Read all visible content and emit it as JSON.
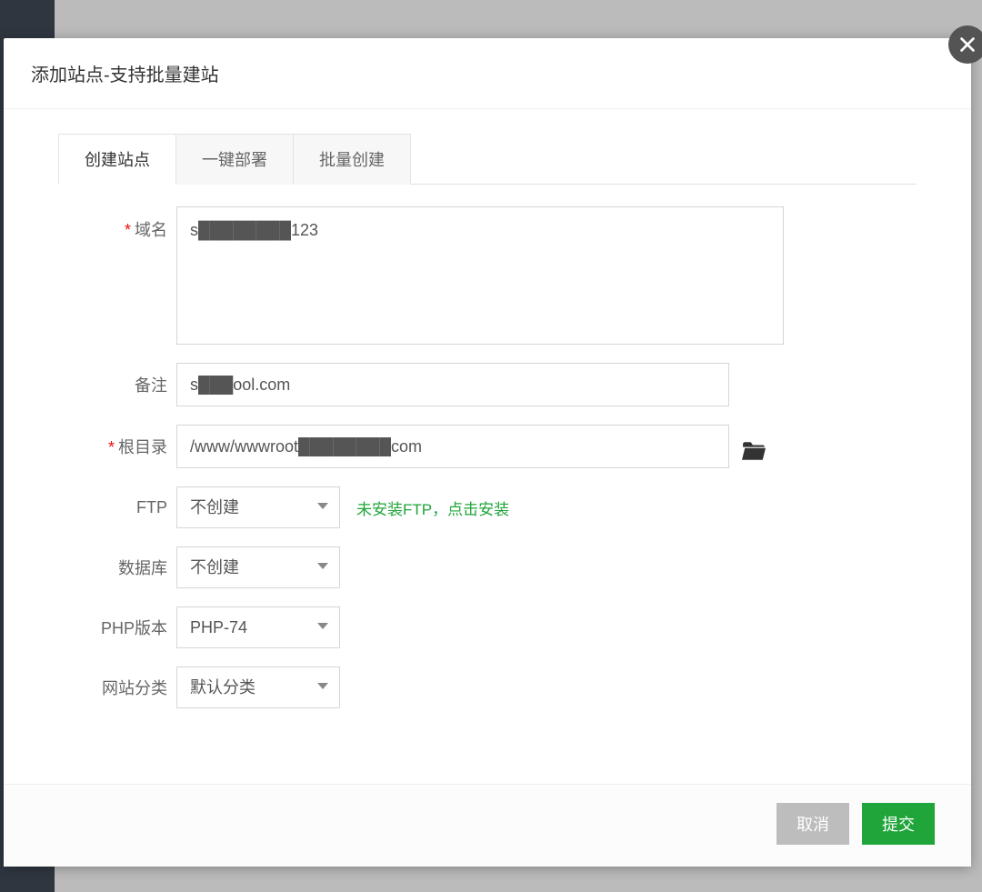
{
  "modal": {
    "title": "添加站点-支持批量建站"
  },
  "tabs": [
    {
      "label": "创建站点",
      "active": true
    },
    {
      "label": "一键部署",
      "active": false
    },
    {
      "label": "批量创建",
      "active": false
    }
  ],
  "form": {
    "domain": {
      "label": "域名",
      "value": "s████████123"
    },
    "remark": {
      "label": "备注",
      "value": "s███ool.com"
    },
    "root_dir": {
      "label": "根目录",
      "value": "/www/wwwroot████████com"
    },
    "ftp": {
      "label": "FTP",
      "value": "不创建",
      "hint": "未安装FTP，点击安装"
    },
    "database": {
      "label": "数据库",
      "value": "不创建"
    },
    "php_version": {
      "label": "PHP版本",
      "value": "PHP-74"
    },
    "site_category": {
      "label": "网站分类",
      "value": "默认分类"
    }
  },
  "footer": {
    "cancel": "取消",
    "submit": "提交"
  }
}
